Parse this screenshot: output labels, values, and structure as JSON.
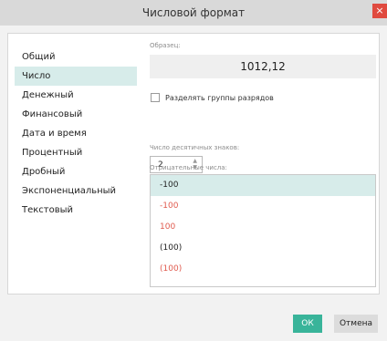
{
  "dialog": {
    "title": "Числовой формат",
    "close_glyph": "×"
  },
  "categories": [
    {
      "label": "Общий"
    },
    {
      "label": "Число",
      "selected": true
    },
    {
      "label": "Денежный"
    },
    {
      "label": "Финансовый"
    },
    {
      "label": "Дата и время"
    },
    {
      "label": "Процентный"
    },
    {
      "label": "Дробный"
    },
    {
      "label": "Экспоненциальный"
    },
    {
      "label": "Текстовый"
    }
  ],
  "sample": {
    "label": "Образец:",
    "value": "1012,12"
  },
  "separator": {
    "label": "Разделять группы разрядов",
    "checked": false
  },
  "decimals": {
    "label": "Число десятичных знаков:",
    "value": "2"
  },
  "negative": {
    "label": "Отрицательные числа:",
    "items": [
      {
        "text": "-100",
        "color": "#222222",
        "selected": true
      },
      {
        "text": "-100",
        "color": "#e05a4e"
      },
      {
        "text": "100",
        "color": "#e05a4e"
      },
      {
        "text": "(100)",
        "color": "#222222"
      },
      {
        "text": "(100)",
        "color": "#e05a4e"
      }
    ]
  },
  "buttons": {
    "ok": "ОК",
    "cancel": "Отмена"
  },
  "colors": {
    "accent": "#39b49a",
    "selection": "#d7ecea",
    "negative_red": "#e05a4e",
    "close": "#e04a3f"
  }
}
